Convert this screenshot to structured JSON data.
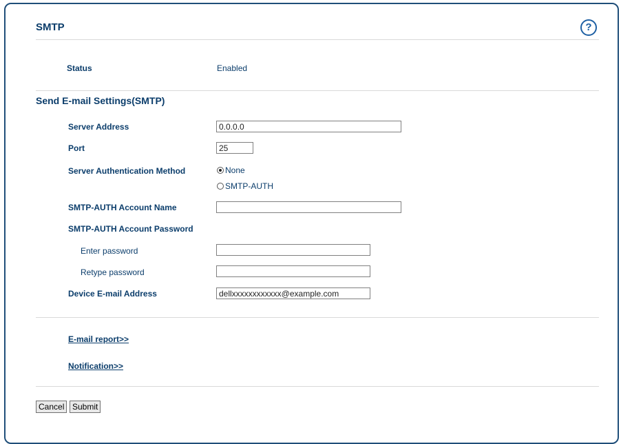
{
  "header": {
    "title": "SMTP",
    "help_icon": "help-icon"
  },
  "status": {
    "label": "Status",
    "value": "Enabled"
  },
  "section": {
    "title": "Send E-mail Settings(SMTP)"
  },
  "form": {
    "server_address": {
      "label": "Server Address",
      "value": "0.0.0.0"
    },
    "port": {
      "label": "Port",
      "value": "25"
    },
    "auth_method": {
      "label": "Server Authentication Method",
      "options": [
        "None",
        "SMTP-AUTH"
      ],
      "selected": "None"
    },
    "account_name": {
      "label": "SMTP-AUTH Account Name",
      "value": ""
    },
    "account_password": {
      "label": "SMTP-AUTH Account Password",
      "enter_label": "Enter password",
      "retype_label": "Retype password"
    },
    "device_email": {
      "label": "Device E-mail Address",
      "value": "dellxxxxxxxxxxxx@example.com"
    }
  },
  "links": {
    "email_report": "E-mail report>>",
    "notification": "Notification>>"
  },
  "buttons": {
    "cancel": "Cancel",
    "submit": "Submit"
  },
  "colors": {
    "accent": "#0b3d6b",
    "frame": "#1f4e79",
    "help": "#1d5fa3"
  }
}
